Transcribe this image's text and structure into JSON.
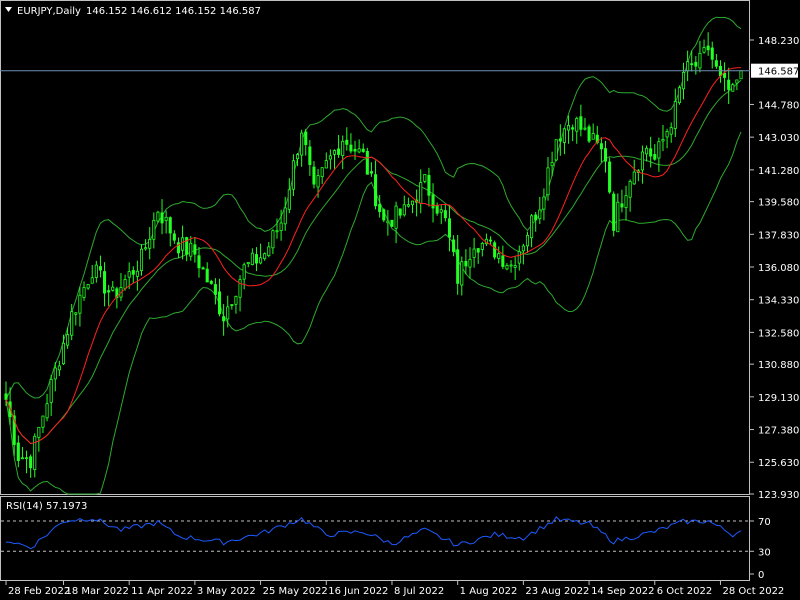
{
  "header": {
    "symbol_label": "EURJPY,Daily",
    "ohlc_text": "146.152 146.612 146.152 146.587",
    "collapse_icon": "triangle-down-icon"
  },
  "rsi_panel": {
    "label": "RSI(14) 57.1973",
    "levels": [
      70,
      30
    ],
    "axis_labels": [
      "70",
      "30",
      "0"
    ],
    "line_color": "#1e5bff",
    "level_color": "#c0c0c0"
  },
  "colors": {
    "background": "#000000",
    "candle": "#22ff22",
    "bollinger": "#2ea82e",
    "moving_average": "#ff2020",
    "current_price_line": "#6e8fb4",
    "current_price_box": "#ffffff",
    "frame": "#c0c0c0"
  },
  "chart_data": {
    "type": "candlestick",
    "symbol": "EURJPY",
    "timeframe": "Daily",
    "last_ohlc": {
      "open": 146.152,
      "high": 146.612,
      "low": 146.152,
      "close": 146.587
    },
    "current_price": 146.587,
    "current_price_label": "146.587",
    "ylim": [
      123.93,
      149.3
    ],
    "price_axis_labels": [
      "148.230",
      "146.587",
      "144.780",
      "143.030",
      "141.280",
      "139.580",
      "137.830",
      "136.080",
      "134.330",
      "132.580",
      "130.880",
      "129.130",
      "127.380",
      "125.630",
      "123.930"
    ],
    "time_axis_labels": [
      "28 Feb 2022",
      "18 Mar 2022",
      "11 Apr 2022",
      "3 May 2022",
      "25 May 2022",
      "16 Jun 2022",
      "8 Jul 2022",
      "1 Aug 2022",
      "23 Aug 2022",
      "14 Sep 2022",
      "6 Oct 2022",
      "28 Oct 2022"
    ],
    "close_anchors": [
      {
        "date": "28 Feb 2022",
        "close": 129.0
      },
      {
        "date": "3 Mar 2022",
        "close": 126.0
      },
      {
        "date": "8 Mar 2022",
        "close": 125.8
      },
      {
        "date": "14 Mar 2022",
        "close": 129.0
      },
      {
        "date": "22 Mar 2022",
        "close": 133.5
      },
      {
        "date": "29 Mar 2022",
        "close": 136.0
      },
      {
        "date": "5 Apr 2022",
        "close": 134.5
      },
      {
        "date": "14 Apr 2022",
        "close": 136.5
      },
      {
        "date": "20 Apr 2022",
        "close": 139.2
      },
      {
        "date": "27 Apr 2022",
        "close": 137.3
      },
      {
        "date": "3 May 2022",
        "close": 136.8
      },
      {
        "date": "12 May 2022",
        "close": 133.5
      },
      {
        "date": "19 May 2022",
        "close": 136.0
      },
      {
        "date": "26 May 2022",
        "close": 136.8
      },
      {
        "date": "1 Jun 2022",
        "close": 138.5
      },
      {
        "date": "8 Jun 2022",
        "close": 143.5
      },
      {
        "date": "13 Jun 2022",
        "close": 140.0
      },
      {
        "date": "16 Jun 2022",
        "close": 141.5
      },
      {
        "date": "22 Jun 2022",
        "close": 143.0
      },
      {
        "date": "29 Jun 2022",
        "close": 142.0
      },
      {
        "date": "6 Jul 2022",
        "close": 138.5
      },
      {
        "date": "13 Jul 2022",
        "close": 139.0
      },
      {
        "date": "20 Jul 2022",
        "close": 140.6
      },
      {
        "date": "27 Jul 2022",
        "close": 138.5
      },
      {
        "date": "1 Aug 2022",
        "close": 135.5
      },
      {
        "date": "5 Aug 2022",
        "close": 137.5
      },
      {
        "date": "12 Aug 2022",
        "close": 137.0
      },
      {
        "date": "18 Aug 2022",
        "close": 136.2
      },
      {
        "date": "23 Aug 2022",
        "close": 137.5
      },
      {
        "date": "29 Aug 2022",
        "close": 139.5
      },
      {
        "date": "2 Sep 2022",
        "close": 143.0
      },
      {
        "date": "8 Sep 2022",
        "close": 144.0
      },
      {
        "date": "14 Sep 2022",
        "close": 143.0
      },
      {
        "date": "20 Sep 2022",
        "close": 142.0
      },
      {
        "date": "22 Sep 2022",
        "close": 138.5
      },
      {
        "date": "28 Sep 2022",
        "close": 141.0
      },
      {
        "date": "4 Oct 2022",
        "close": 142.5
      },
      {
        "date": "6 Oct 2022",
        "close": 141.8
      },
      {
        "date": "13 Oct 2022",
        "close": 144.5
      },
      {
        "date": "17 Oct 2022",
        "close": 146.5
      },
      {
        "date": "21 Oct 2022",
        "close": 147.0
      },
      {
        "date": "25 Oct 2022",
        "close": 147.8
      },
      {
        "date": "28 Oct 2022",
        "close": 146.0
      },
      {
        "date": "2 Nov 2022",
        "close": 145.3
      },
      {
        "date": "4 Nov 2022",
        "close": 146.587
      }
    ],
    "rsi_anchors": [
      {
        "date": "28 Feb 2022",
        "rsi": 45
      },
      {
        "date": "8 Mar 2022",
        "rsi": 35
      },
      {
        "date": "18 Mar 2022",
        "rsi": 70
      },
      {
        "date": "29 Mar 2022",
        "rsi": 74
      },
      {
        "date": "7 Apr 2022",
        "rsi": 58
      },
      {
        "date": "20 Apr 2022",
        "rsi": 68
      },
      {
        "date": "27 Apr 2022",
        "rsi": 50
      },
      {
        "date": "12 May 2022",
        "rsi": 42
      },
      {
        "date": "26 May 2022",
        "rsi": 55
      },
      {
        "date": "8 Jun 2022",
        "rsi": 73
      },
      {
        "date": "16 Jun 2022",
        "rsi": 52
      },
      {
        "date": "29 Jun 2022",
        "rsi": 56
      },
      {
        "date": "8 Jul 2022",
        "rsi": 40
      },
      {
        "date": "20 Jul 2022",
        "rsi": 58
      },
      {
        "date": "1 Aug 2022",
        "rsi": 38
      },
      {
        "date": "12 Aug 2022",
        "rsi": 52
      },
      {
        "date": "23 Aug 2022",
        "rsi": 48
      },
      {
        "date": "2 Sep 2022",
        "rsi": 72
      },
      {
        "date": "14 Sep 2022",
        "rsi": 66
      },
      {
        "date": "22 Sep 2022",
        "rsi": 43
      },
      {
        "date": "6 Oct 2022",
        "rsi": 56
      },
      {
        "date": "17 Oct 2022",
        "rsi": 69
      },
      {
        "date": "25 Oct 2022",
        "rsi": 70
      },
      {
        "date": "2 Nov 2022",
        "rsi": 52
      },
      {
        "date": "4 Nov 2022",
        "rsi": 57.2
      }
    ],
    "indicators": [
      "Bollinger Bands",
      "Moving Average",
      "RSI(14)"
    ],
    "grid": false,
    "legend": "none"
  }
}
